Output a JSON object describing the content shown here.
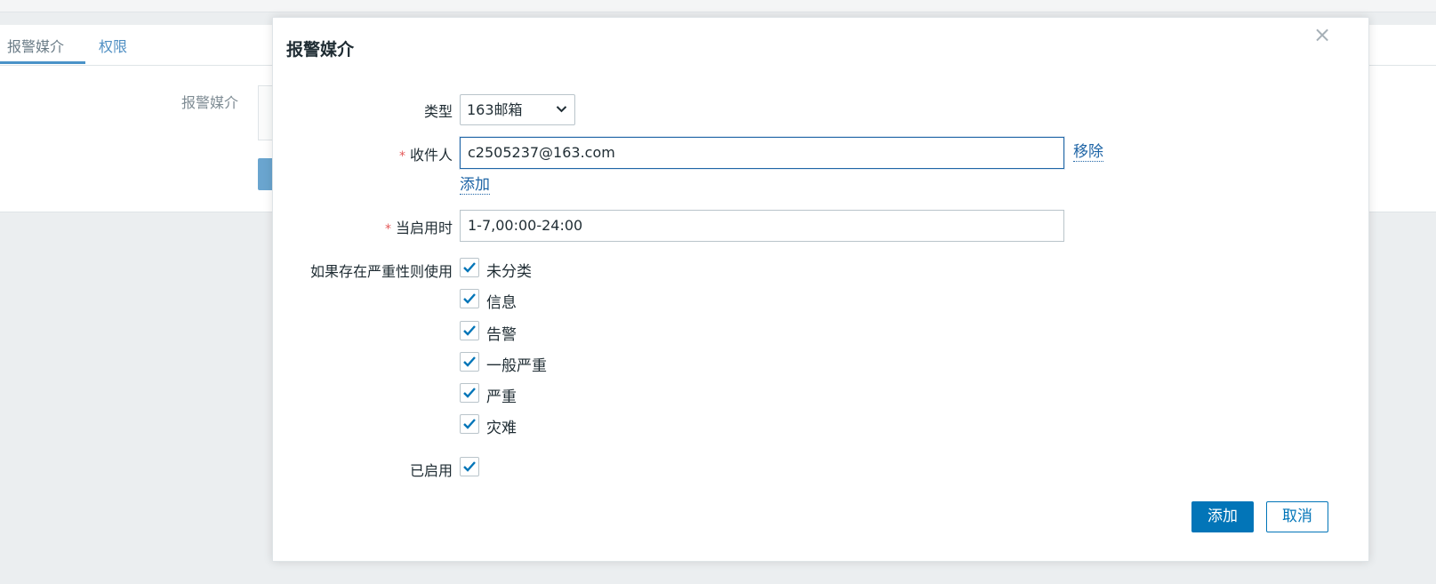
{
  "background": {
    "tabs": [
      {
        "label": "报警媒介",
        "active": true
      },
      {
        "label": "权限",
        "active": false
      }
    ],
    "field_label": "报警媒介"
  },
  "dialog": {
    "title": "报警媒介",
    "close_icon": "close-icon",
    "type": {
      "label": "类型",
      "value": "163邮箱"
    },
    "send_to": {
      "label": "收件人",
      "value": "c2505237@163.com",
      "remove_label": "移除",
      "add_label": "添加",
      "required": true
    },
    "when_active": {
      "label": "当启用时",
      "value": "1-7,00:00-24:00",
      "required": true
    },
    "severity": {
      "label": "如果存在严重性则使用",
      "items": [
        {
          "label": "未分类",
          "checked": true
        },
        {
          "label": "信息",
          "checked": true
        },
        {
          "label": "告警",
          "checked": true
        },
        {
          "label": "一般严重",
          "checked": true
        },
        {
          "label": "严重",
          "checked": true
        },
        {
          "label": "灾难",
          "checked": true
        }
      ]
    },
    "enabled": {
      "label": "已启用",
      "checked": true
    },
    "buttons": {
      "add": "添加",
      "cancel": "取消"
    }
  },
  "colors": {
    "accent": "#0275b8",
    "required": "#e45959",
    "link": "#1f65a6"
  }
}
